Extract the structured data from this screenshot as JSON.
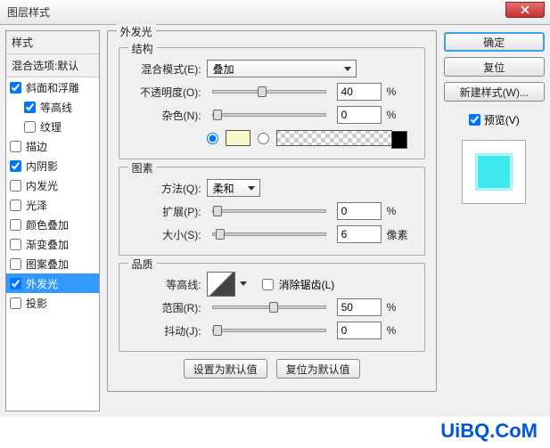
{
  "title": "图层样式",
  "sidebar": {
    "header": "样式",
    "sub": "混合选项:默认",
    "items": [
      {
        "label": "斜面和浮雕",
        "checked": true,
        "indent": false
      },
      {
        "label": "等高线",
        "checked": true,
        "indent": true
      },
      {
        "label": "纹理",
        "checked": false,
        "indent": true
      },
      {
        "label": "描边",
        "checked": false,
        "indent": false
      },
      {
        "label": "内阴影",
        "checked": true,
        "indent": false
      },
      {
        "label": "内发光",
        "checked": false,
        "indent": false
      },
      {
        "label": "光泽",
        "checked": false,
        "indent": false
      },
      {
        "label": "颜色叠加",
        "checked": false,
        "indent": false
      },
      {
        "label": "渐变叠加",
        "checked": false,
        "indent": false
      },
      {
        "label": "图案叠加",
        "checked": false,
        "indent": false
      },
      {
        "label": "外发光",
        "checked": true,
        "indent": false,
        "selected": true
      },
      {
        "label": "投影",
        "checked": false,
        "indent": false
      }
    ]
  },
  "panel": {
    "title": "外发光",
    "structure": {
      "legend": "结构",
      "blend_label": "混合模式(E):",
      "blend_value": "叠加",
      "opacity_label": "不透明度(O):",
      "opacity_value": "40",
      "opacity_unit": "%",
      "noise_label": "杂色(N):",
      "noise_value": "0",
      "noise_unit": "%",
      "color_hex": "#f7f7c8"
    },
    "elements": {
      "legend": "图素",
      "technique_label": "方法(Q):",
      "technique_value": "柔和",
      "spread_label": "扩展(P):",
      "spread_value": "0",
      "spread_unit": "%",
      "size_label": "大小(S):",
      "size_value": "6",
      "size_unit": "像素"
    },
    "quality": {
      "legend": "品质",
      "contour_label": "等高线:",
      "antialias_label": "消除锯齿(L)",
      "range_label": "范围(R):",
      "range_value": "50",
      "range_unit": "%",
      "jitter_label": "抖动(J):",
      "jitter_value": "0",
      "jitter_unit": "%"
    },
    "reset_btn": "设置为默认值",
    "restore_btn": "复位为默认值"
  },
  "right": {
    "ok": "确定",
    "cancel": "复位",
    "new_style": "新建样式(W)...",
    "preview_label": "预览(V)"
  },
  "watermark": "UiBQ.CoM"
}
